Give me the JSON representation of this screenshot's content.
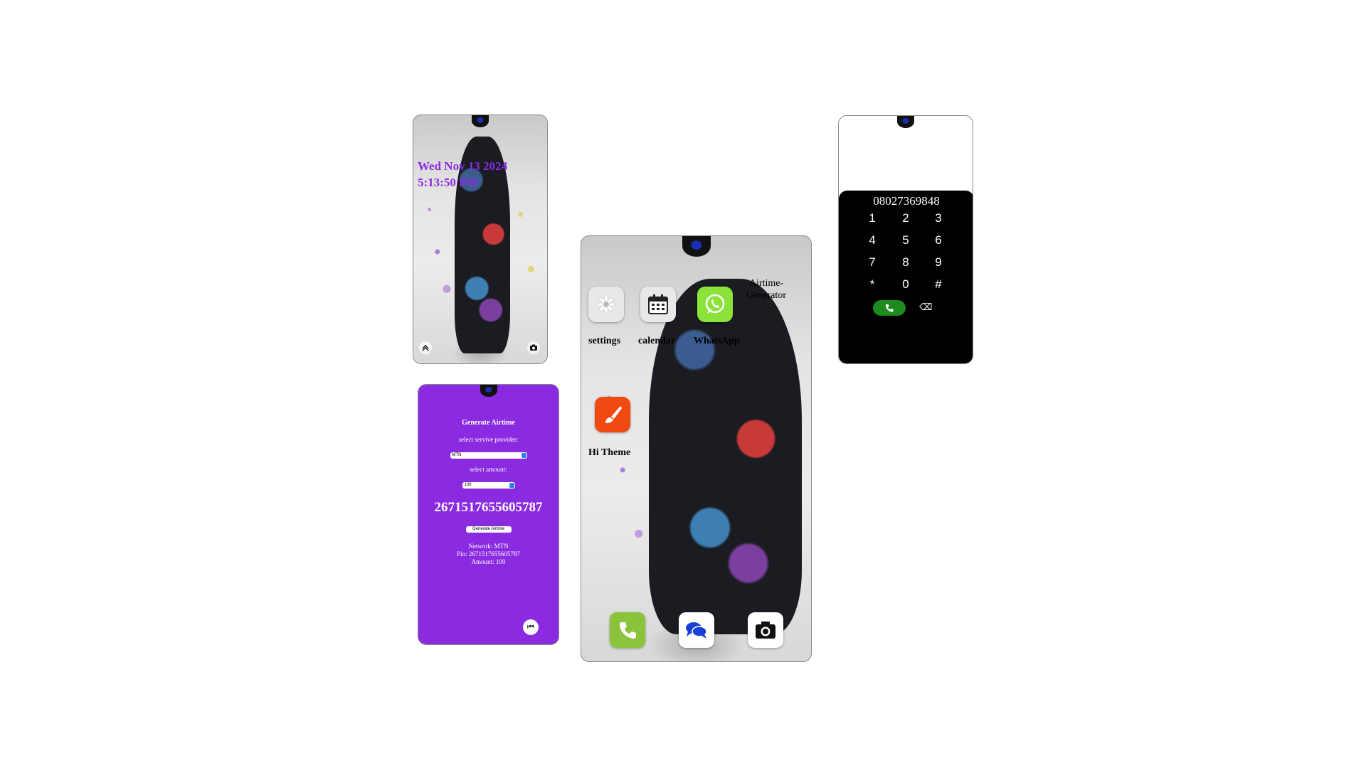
{
  "lock_screen": {
    "date": "Wed Nov 13 2024",
    "time": "5:13:50 PM",
    "icons": [
      "chevron-up-icon",
      "camera-icon"
    ]
  },
  "airtime_app": {
    "title": "Generate Airtime",
    "provider_label": "select servive provider:",
    "provider_value": "MTN",
    "amount_label": "select amount:",
    "amount_value": "100",
    "pin_display": "2671517655605787",
    "generate_button": "Generate Airtime",
    "result_network": "Network: MTN",
    "result_pin": "Pin: 2671517655605787",
    "result_amount": "Amount: 100",
    "back_icon": "rewind-icon",
    "background_color": "#8a2be2"
  },
  "home_screen": {
    "apps": [
      {
        "label": "settings",
        "icon": "gear-icon"
      },
      {
        "label": "calendar",
        "icon": "calendar-icon"
      },
      {
        "label": "WhatsApp",
        "icon": "whatsapp-icon"
      },
      {
        "label": "Airtime-Generator",
        "icon": ""
      },
      {
        "label": "Hi Theme",
        "icon": "paintbrush-icon"
      }
    ],
    "dock": [
      {
        "name": "phone",
        "icon": "phone-icon"
      },
      {
        "name": "messages",
        "icon": "chat-icon"
      },
      {
        "name": "camera",
        "icon": "camera-icon"
      }
    ]
  },
  "dialer": {
    "number": "08027369848",
    "keys": [
      "1",
      "2",
      "3",
      "4",
      "5",
      "6",
      "7",
      "8",
      "9",
      "*",
      "0",
      "#"
    ],
    "call_icon": "phone-icon",
    "delete_icon": "backspace-icon",
    "call_color": "#1d8b1d"
  }
}
